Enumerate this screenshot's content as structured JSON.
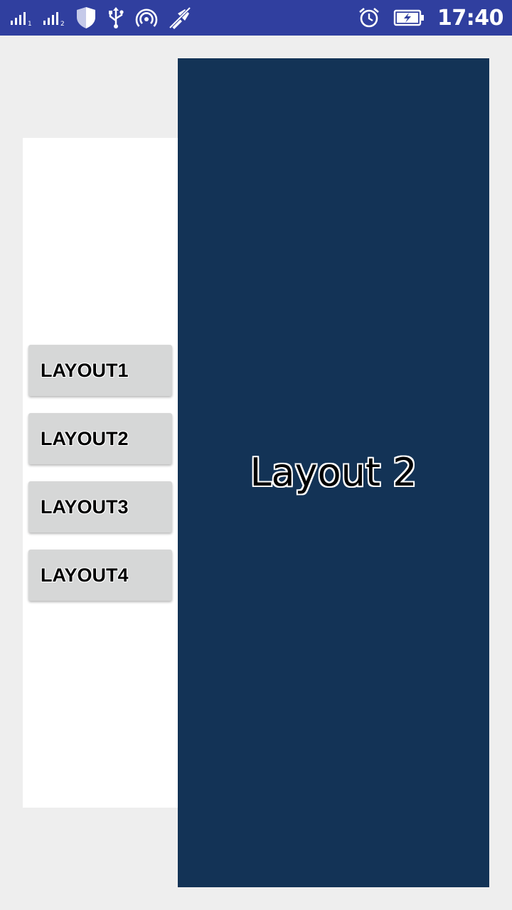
{
  "status_bar": {
    "time": "17:40",
    "icons_left": [
      "signal-sim1-icon",
      "signal-sim2-icon",
      "shield-icon",
      "usb-icon",
      "hotspot-icon",
      "no-location-icon"
    ],
    "icons_right": [
      "alarm-icon",
      "battery-charging-icon"
    ],
    "background": "#303f9f"
  },
  "menu": {
    "buttons": [
      {
        "label": "LAYOUT1"
      },
      {
        "label": "LAYOUT2"
      },
      {
        "label": "LAYOUT3"
      },
      {
        "label": "LAYOUT4"
      }
    ]
  },
  "content": {
    "title": "Layout 2",
    "background": "#133356"
  }
}
